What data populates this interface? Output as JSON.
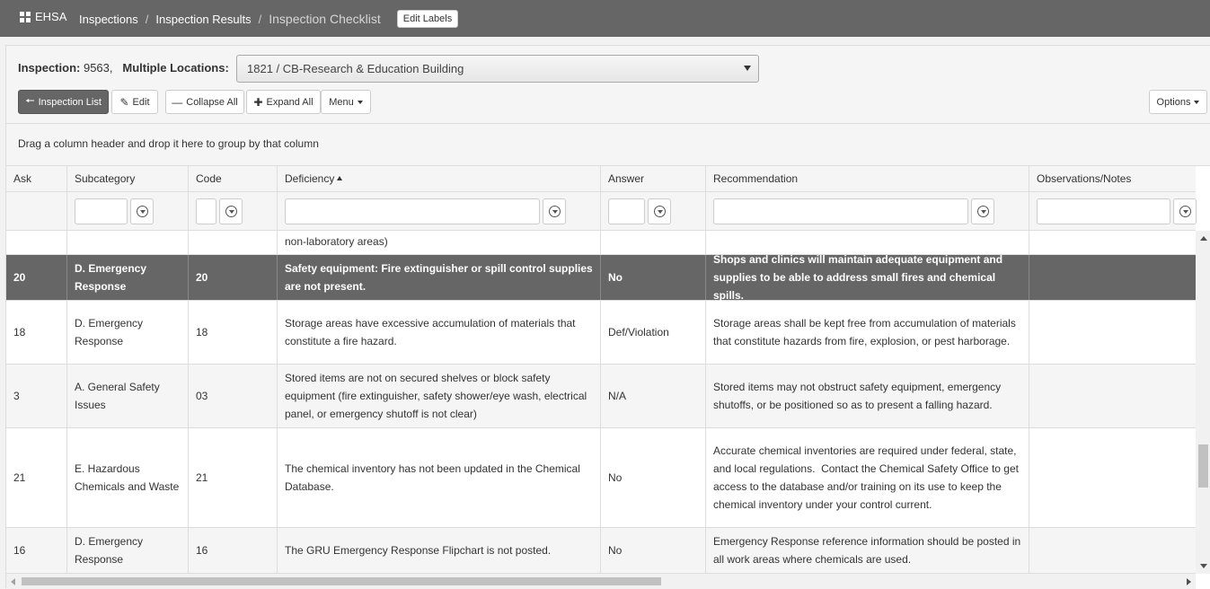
{
  "topbar": {
    "brand": "EHSA",
    "breadcrumbs": [
      "Inspections",
      "Inspection Results"
    ],
    "current": "Inspection Checklist",
    "separator": "/",
    "edit_labels": "Edit Labels"
  },
  "inspection": {
    "label": "Inspection:",
    "number": "9563,",
    "locations_label": "Multiple Locations:",
    "selected_location": "1821 / CB-Research & Education Building"
  },
  "toolbar": {
    "inspection_list": "Inspection List",
    "edit": "Edit",
    "collapse_all": "Collapse All",
    "expand_all": "Expand All",
    "menu": "Menu",
    "options": "Options"
  },
  "group_hint": "Drag a column header and drop it here to group by that column",
  "columns": {
    "ask": "Ask",
    "subcategory": "Subcategory",
    "code": "Code",
    "deficiency": "Deficiency",
    "answer": "Answer",
    "recommendation": "Recommendation",
    "notes": "Observations/Notes"
  },
  "rows": [
    {
      "ask": "",
      "subcategory": "",
      "code": "",
      "deficiency": "non-laboratory areas)",
      "answer": "",
      "recommendation": "",
      "notes": ""
    },
    {
      "ask": "20",
      "subcategory": "D. Emergency Response",
      "code": "20",
      "deficiency": "Safety equipment: Fire extinguisher or spill control supplies are not present.",
      "answer": "No",
      "recommendation": "Shops and clinics will maintain adequate equipment and supplies to be able to address small fires and chemical spills.",
      "notes": ""
    },
    {
      "ask": "18",
      "subcategory": "D. Emergency Response",
      "code": "18",
      "deficiency": "Storage areas have excessive accumulation of materials that constitute a fire hazard.",
      "answer": "Def/Violation",
      "recommendation": "Storage areas shall be kept free from accumulation of materials that constitute hazards from fire, explosion, or pest harborage.",
      "notes": ""
    },
    {
      "ask": "3",
      "subcategory": "A. General Safety Issues",
      "code": "03",
      "deficiency": "Stored items are not on secured shelves or block safety equipment (fire extinguisher, safety shower/eye wash, electrical panel, or emergency shutoff is not clear)",
      "answer": "N/A",
      "recommendation": "Stored items may not obstruct safety equipment, emergency shutoffs, or be positioned so as to present a falling hazard.",
      "notes": ""
    },
    {
      "ask": "21",
      "subcategory": "E. Hazardous Chemicals and Waste",
      "code": "21",
      "deficiency": "The chemical inventory has not been updated in the Chemical Database.",
      "answer": "No",
      "recommendation": "Accurate chemical inventories are required under federal, state, and local regulations.  Contact the Chemical Safety Office to get access to the database and/or training on its use to keep the chemical inventory under your control current.",
      "notes": ""
    },
    {
      "ask": "16",
      "subcategory": "D. Emergency Response",
      "code": "16",
      "deficiency": "The GRU Emergency Response Flipchart is not posted.",
      "answer": "No",
      "recommendation": "Emergency Response reference information should be posted in all work areas where chemicals are used.",
      "notes": ""
    }
  ]
}
